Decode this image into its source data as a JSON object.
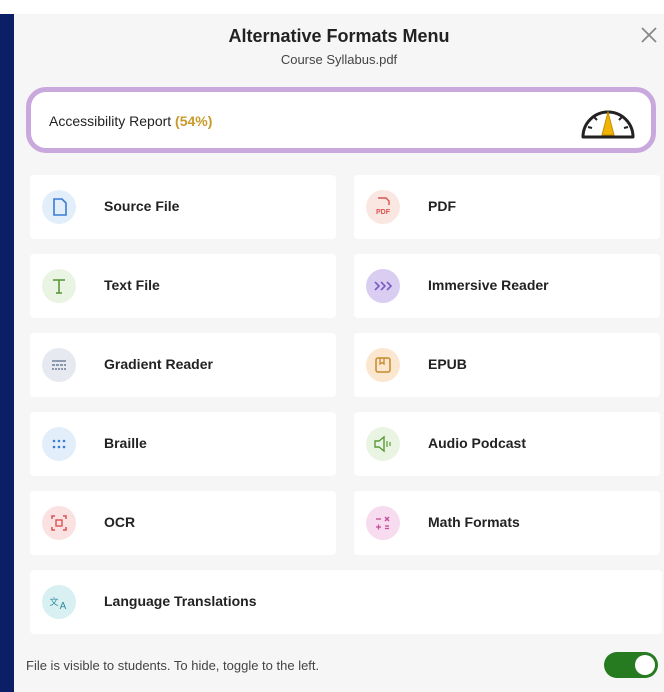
{
  "header": {
    "title": "Alternative Formats Menu",
    "subtitle": "Course Syllabus.pdf"
  },
  "report": {
    "label": "Accessibility Report",
    "score": "(54%)",
    "score_value": 54,
    "score_color": "#c89a2a",
    "border_color": "#c9a8de"
  },
  "formats": [
    {
      "label": "Source File",
      "icon": "file-icon",
      "color": "#3a7bd5"
    },
    {
      "label": "PDF",
      "icon": "pdf-icon",
      "color": "#d9534f"
    },
    {
      "label": "Text File",
      "icon": "text-t-icon",
      "color": "#5a9a3a"
    },
    {
      "label": "Immersive Reader",
      "icon": "chevrons-icon",
      "color": "#7a5cc4"
    },
    {
      "label": "Gradient Reader",
      "icon": "lines-icon",
      "color": "#6a7a99"
    },
    {
      "label": "EPUB",
      "icon": "book-icon",
      "color": "#c8892a"
    },
    {
      "label": "Braille",
      "icon": "dots-icon",
      "color": "#3a7bd5"
    },
    {
      "label": "Audio Podcast",
      "icon": "speaker-icon",
      "color": "#5a9a3a"
    },
    {
      "label": "OCR",
      "icon": "scan-icon",
      "color": "#d9534f"
    },
    {
      "label": "Math Formats",
      "icon": "math-icon",
      "color": "#c94a9a"
    },
    {
      "label": "Language Translations",
      "icon": "translate-icon",
      "color": "#2a8a9a"
    }
  ],
  "footer": {
    "text": "File is visible to students. To hide, toggle to the left.",
    "toggle_on": true,
    "toggle_color": "#267a1f"
  }
}
